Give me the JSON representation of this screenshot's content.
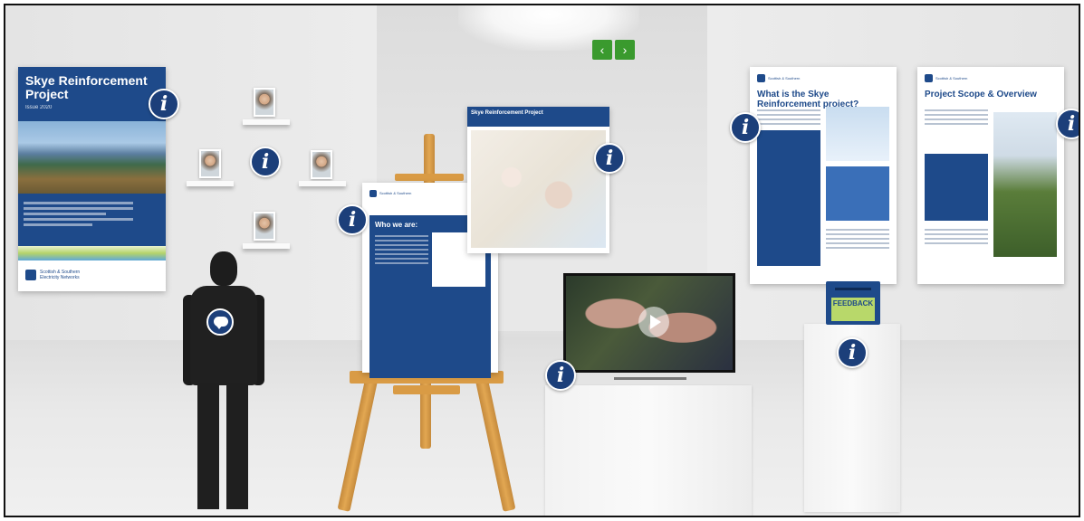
{
  "navigation": {
    "prev_label": "‹",
    "next_label": "›"
  },
  "poster": {
    "title": "Skye Reinforcement Project",
    "date": "Issue 2020",
    "logo_text": "Scottish & Southern Electricity Networks"
  },
  "easel_board": {
    "title": "Who we are:",
    "logo_text": "Scottish & Southern"
  },
  "map": {
    "title": "Skye Reinforcement Project"
  },
  "brochure_1": {
    "title": "What is the Skye Reinforcement project?",
    "logo_text": "Scottish & Southern"
  },
  "brochure_2": {
    "title": "Project Scope & Overview",
    "logo_text": "Scottish & Southern"
  },
  "feedback": {
    "label": "FEEDBACK"
  },
  "icons": {
    "info": "info-icon",
    "chat": "chat-icon",
    "play": "play-icon"
  },
  "info_glyph": "i",
  "colors": {
    "brand_blue": "#1c3f7a",
    "nav_green": "#3a9a2e",
    "feedback_green": "#b8d86a"
  }
}
